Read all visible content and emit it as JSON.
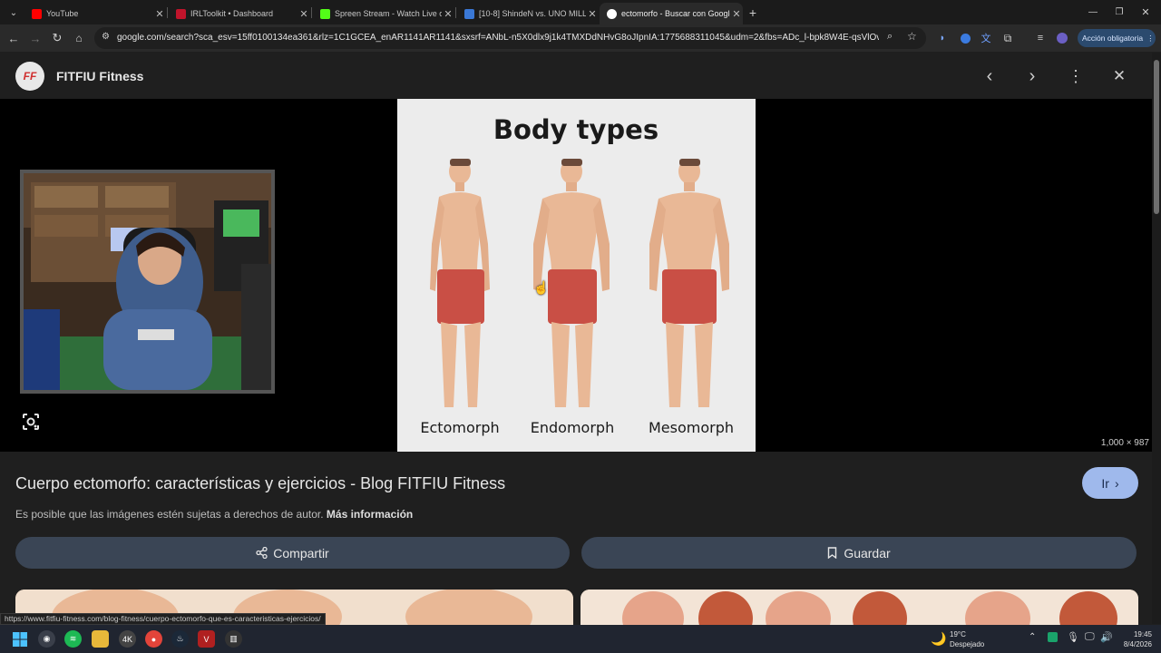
{
  "browser": {
    "tabs": [
      {
        "title": "YouTube",
        "favicon_color": "#ff0000"
      },
      {
        "title": "IRLToolkit • Dashboard",
        "favicon_color": "#c0142b"
      },
      {
        "title": "Spreen Stream - Watch Live on",
        "favicon_color": "#53fc18"
      },
      {
        "title": "[10-8] ShindeN vs. UNO MILLE",
        "favicon_color": "#3a78d6"
      },
      {
        "title": "ectomorfo - Buscar con Google",
        "favicon_color": "#ffffff"
      }
    ],
    "new_tab_symbol": "+",
    "url": "google.com/search?sca_esv=15ff0100134ea361&rlz=1C1GCEA_enAR1141AR1141&sxsrf=ANbL-n5X0dlx9j1k4TMXDdNHvG8oJIpnIA:1775688311045&udm=2&fbs=ADc_l-bpk8W4E-qsVlOvbGJcDwpn60D...",
    "action_button": "Acción obligatoria",
    "status_url": "https://www.fitfiu-fitness.com/blog-fitness/cuerpo-ectomorfo-que-es-caracteristicas-ejercicios/"
  },
  "viewer": {
    "logo_text": "FF",
    "site_name": "FITFIU Fitness",
    "image": {
      "heading": "Body types",
      "labels": [
        "Ectomorph",
        "Endomorph",
        "Mesomorph"
      ],
      "dimensions": "1,000 × 987"
    },
    "title": "Cuerpo ectomorfo: características y ejercicios - Blog FITFIU Fitness",
    "go_label": "Ir",
    "copyright_notice": "Es posible que las imágenes estén sujetas a derechos de autor.",
    "more_info": "Más información",
    "share_label": "Compartir",
    "save_label": "Guardar"
  },
  "taskbar": {
    "weather_temp": "19°C",
    "weather_desc": "Despejado",
    "time": "19:45",
    "date": "8/4/2026"
  },
  "colors": {
    "accent_button": "#9fb9ec",
    "pill_bg": "#3a4555",
    "shorts_red": "#c94f45"
  }
}
